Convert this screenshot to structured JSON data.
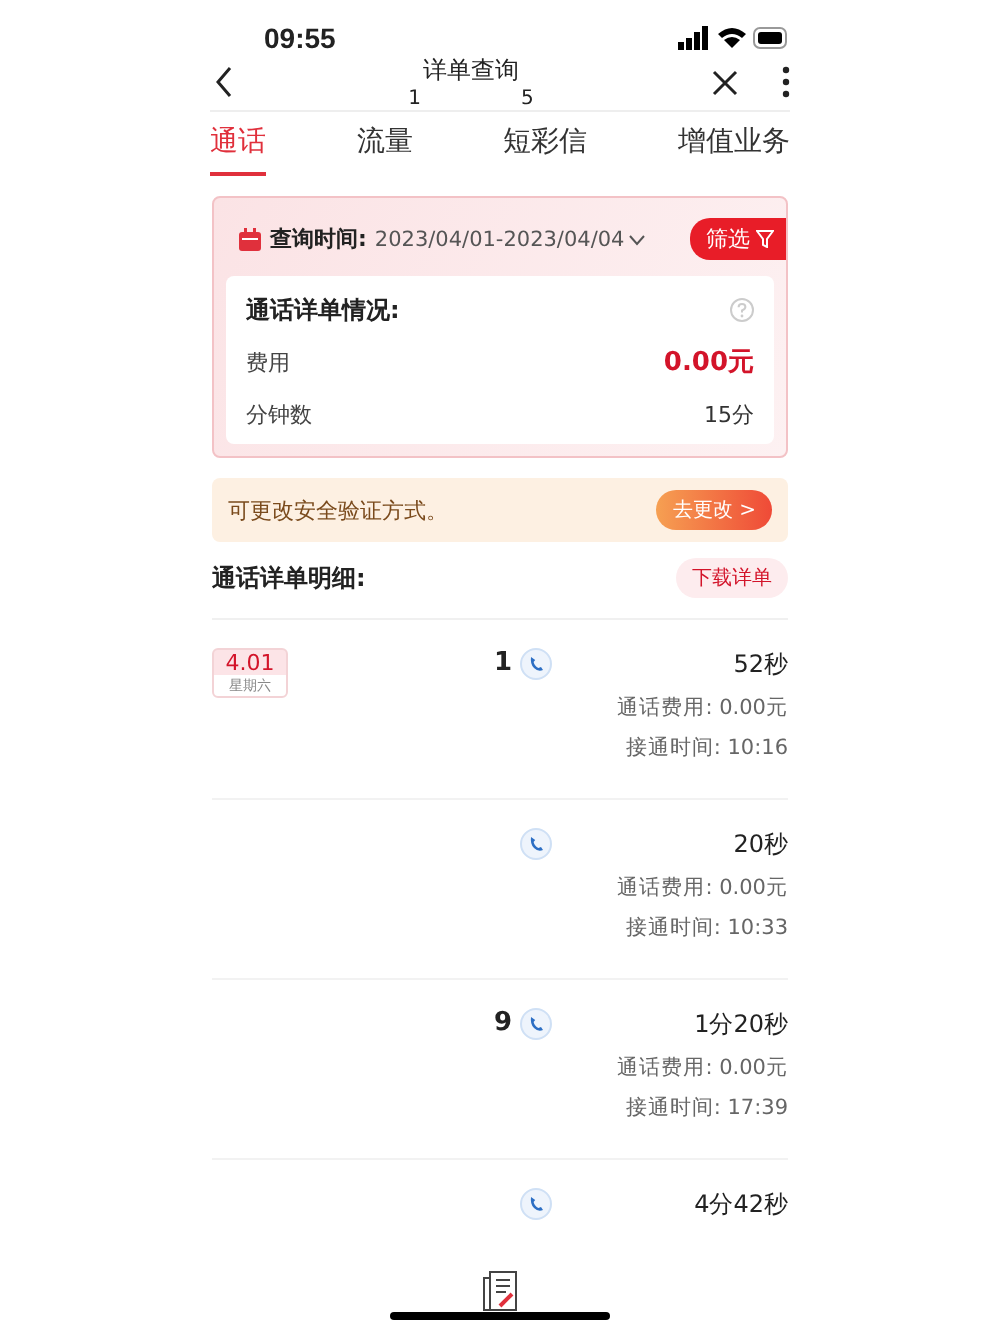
{
  "status_bar": {
    "time": "09:55"
  },
  "header": {
    "title": "详单查询",
    "subtitle_parts": [
      "1",
      "5"
    ]
  },
  "tabs": [
    {
      "label": "通话",
      "selected": true
    },
    {
      "label": "流量",
      "selected": false
    },
    {
      "label": "短彩信",
      "selected": false
    },
    {
      "label": "增值业务",
      "selected": false
    }
  ],
  "query": {
    "label": "查询时间:",
    "range": "2023/04/01-2023/04/04",
    "filter_button": "筛选"
  },
  "summary": {
    "title": "通话详单情况:",
    "rows": [
      {
        "label": "费用",
        "value": "0.00元",
        "kind": "highlight"
      },
      {
        "label": "分钟数",
        "value": "15分",
        "kind": "plain"
      }
    ]
  },
  "banner": {
    "text": "可更改安全验证方式。",
    "button": "去更改 >"
  },
  "details": {
    "title": "通话详单明细:",
    "download_button": "下载详单"
  },
  "calls": [
    {
      "date": "4.01",
      "weekday": "星期六",
      "number": "1",
      "duration": "52秒",
      "fee": "通话费用: 0.00元",
      "time": "接通时间: 10:16"
    },
    {
      "duration": "20秒",
      "fee": "通话费用: 0.00元",
      "time": "接通时间: 10:33"
    },
    {
      "number": "9",
      "duration": "1分20秒",
      "fee": "通话费用: 0.00元",
      "time": "接通时间: 17:39"
    },
    {
      "duration": "4分42秒"
    }
  ]
}
